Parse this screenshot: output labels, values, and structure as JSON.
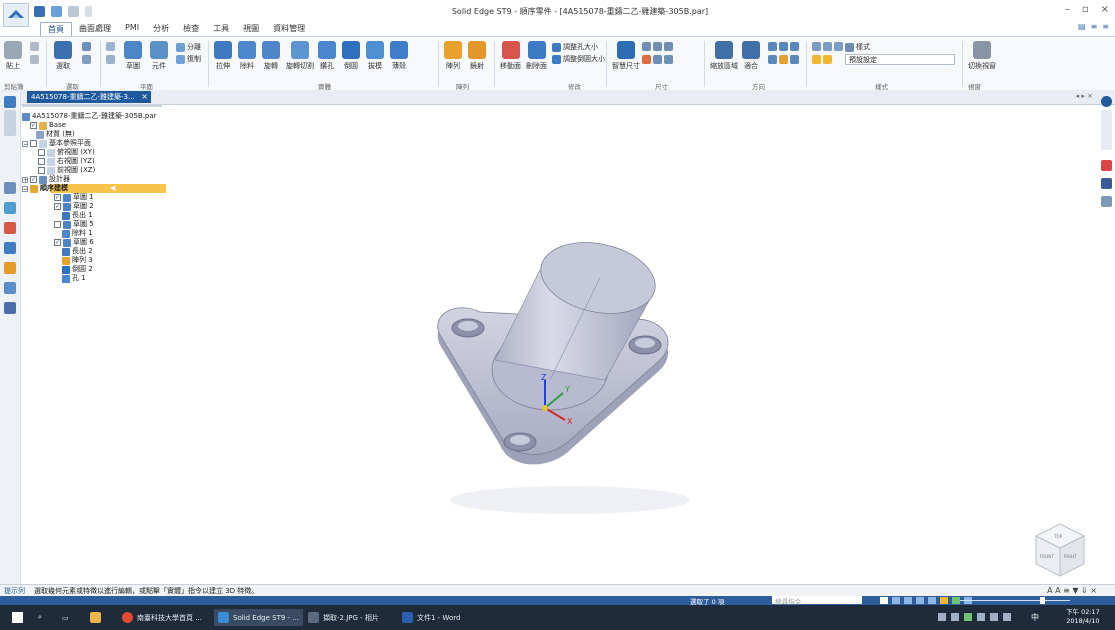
{
  "titlebar": {
    "title": "Solid Edge ST9 - 順序零件 - [4A515078-重鑄二乙-雞建築-305B.par]",
    "controls": [
      "–",
      "▫",
      "×"
    ]
  },
  "tabs": [
    {
      "label": "首頁",
      "active": true
    },
    {
      "label": "曲面處理"
    },
    {
      "label": "PMI"
    },
    {
      "label": "分析"
    },
    {
      "label": "檢查"
    },
    {
      "label": "工具"
    },
    {
      "label": "視圖"
    },
    {
      "label": "資料管理"
    }
  ],
  "ribbon": {
    "buttons": [
      {
        "label": "貼上",
        "icon": "paste-icon",
        "color": "#9aa7b6"
      },
      {
        "label": "選取",
        "icon": "select-arrow-icon",
        "color": "#3b6fb0"
      },
      {
        "label": "草圖",
        "icon": "sketch-icon",
        "color": "#4c86c6"
      },
      {
        "label": "元件",
        "icon": "component-icon",
        "color": "#5a92c8"
      },
      {
        "label": "拉伸",
        "icon": "extrude-icon",
        "color": "#3f79c0"
      },
      {
        "label": "除料",
        "icon": "cutout-icon",
        "color": "#4d88cc"
      },
      {
        "label": "旋轉",
        "icon": "revolve-icon",
        "color": "#4f85c9"
      },
      {
        "label": "旋轉切割",
        "icon": "revolve-cut-icon",
        "color": "#5d95d2"
      },
      {
        "label": "鑽孔",
        "icon": "hole-icon",
        "color": "#4a86ce"
      },
      {
        "label": "倒圓",
        "icon": "round-icon",
        "color": "#2f6fbf"
      },
      {
        "label": "拔模",
        "icon": "draft-icon",
        "color": "#4e8ed3"
      },
      {
        "label": "薄殼",
        "icon": "thin-wall-icon",
        "color": "#3e7dc7"
      },
      {
        "label": "陣列",
        "icon": "pattern-icon",
        "color": "#e7a12c"
      },
      {
        "label": "鏡射",
        "icon": "mirror-icon",
        "color": "#e3972a"
      },
      {
        "label": "移動面",
        "icon": "move-face-icon",
        "color": "#d6544a"
      },
      {
        "label": "刪除面",
        "icon": "delete-face-icon",
        "color": "#3c7bc4"
      },
      {
        "label": "智慧尺寸",
        "icon": "smart-dimension-icon",
        "color": "#2d6db3"
      },
      {
        "label": "縮放區域",
        "icon": "zoom-area-icon",
        "color": "#3f6fa6"
      },
      {
        "label": "適合",
        "icon": "fit-icon",
        "color": "#3f6fa6"
      },
      {
        "label": "切換視窗",
        "icon": "switch-window-icon",
        "color": "#8895a6"
      }
    ],
    "small_labels": [
      "調整孔大小",
      "調整倒圓大小",
      "分離",
      "復制",
      "樣式"
    ],
    "groups": [
      "剪貼簿",
      "選取",
      "平面",
      "實體",
      "陣列",
      "修改",
      "尺寸",
      "方向",
      "樣式",
      "視窗"
    ],
    "style_select": "預設設定"
  },
  "doc_tab": {
    "label": "4A515078-重鑄二乙-雞建築-3...",
    "close": "×"
  },
  "tab_nav": "◂ ▸ ×",
  "tree": {
    "root": "4A515078-重鑄二乙-雞建築-305B.par",
    "items": [
      {
        "label": "Base",
        "indent": 1,
        "check": true
      },
      {
        "label": "材質 (無)",
        "indent": 1
      },
      {
        "label": "基本參照平面",
        "indent": 0,
        "expander": "⊟",
        "check": false
      },
      {
        "label": "俯視圖 (XY)",
        "indent": 1,
        "check": false
      },
      {
        "label": "右視圖 (YZ)",
        "indent": 1,
        "check": false
      },
      {
        "label": "前視圖 (XZ)",
        "indent": 1,
        "check": false
      },
      {
        "label": "設計器",
        "indent": 0,
        "expander": "⊞",
        "check": true
      },
      {
        "label": "順序建模",
        "indent": 0,
        "expander": "⊟",
        "highlight": true
      },
      {
        "label": "草圖 1",
        "indent": 2,
        "check": true
      },
      {
        "label": "草圖 2",
        "indent": 2,
        "check": true
      },
      {
        "label": "長出 1",
        "indent": 2
      },
      {
        "label": "草圖 5",
        "indent": 2,
        "check": false
      },
      {
        "label": "除料 1",
        "indent": 2
      },
      {
        "label": "草圖 6",
        "indent": 2,
        "check": true
      },
      {
        "label": "長出 2",
        "indent": 2
      },
      {
        "label": "陣列 3",
        "indent": 2
      },
      {
        "label": "倒圓 2",
        "indent": 2
      },
      {
        "label": "孔 1",
        "indent": 2
      }
    ]
  },
  "prompt": {
    "label": "提示列",
    "text": "選取幾何元素或特徵以進行編輯，或點擊「實體」指令以建立 3D 特徵。",
    "right": "A A ≡ ▼ ⇓ ×"
  },
  "status": {
    "selection": "選取了 0 項",
    "search_placeholder": "搜尋指令"
  },
  "taskbar": {
    "items": [
      {
        "label": "南臺科技大學首頁 ...",
        "icon": "chrome-icon",
        "color": "#e04a2f"
      },
      {
        "label": "Solid Edge ST9 - ...",
        "icon": "solid-edge-icon",
        "color": "#3a8ad6",
        "active": true
      },
      {
        "label": "擷取-2.JPG - 相片",
        "icon": "photos-icon",
        "color": "#5a6b80"
      },
      {
        "label": "文件1 - Word",
        "icon": "word-icon",
        "color": "#2b5fad"
      }
    ],
    "time": "下午 02:17",
    "date": "2018/4/10",
    "ime": "中"
  },
  "viewcube": {
    "faces": [
      "TOP",
      "FRONT",
      "RIGHT"
    ]
  },
  "axes": {
    "z": "Z",
    "x": "X",
    "y": "Y"
  },
  "colors": {
    "accent": "#1e5a9c",
    "highlight": "#f7c44a",
    "part": "#c9cddd"
  }
}
